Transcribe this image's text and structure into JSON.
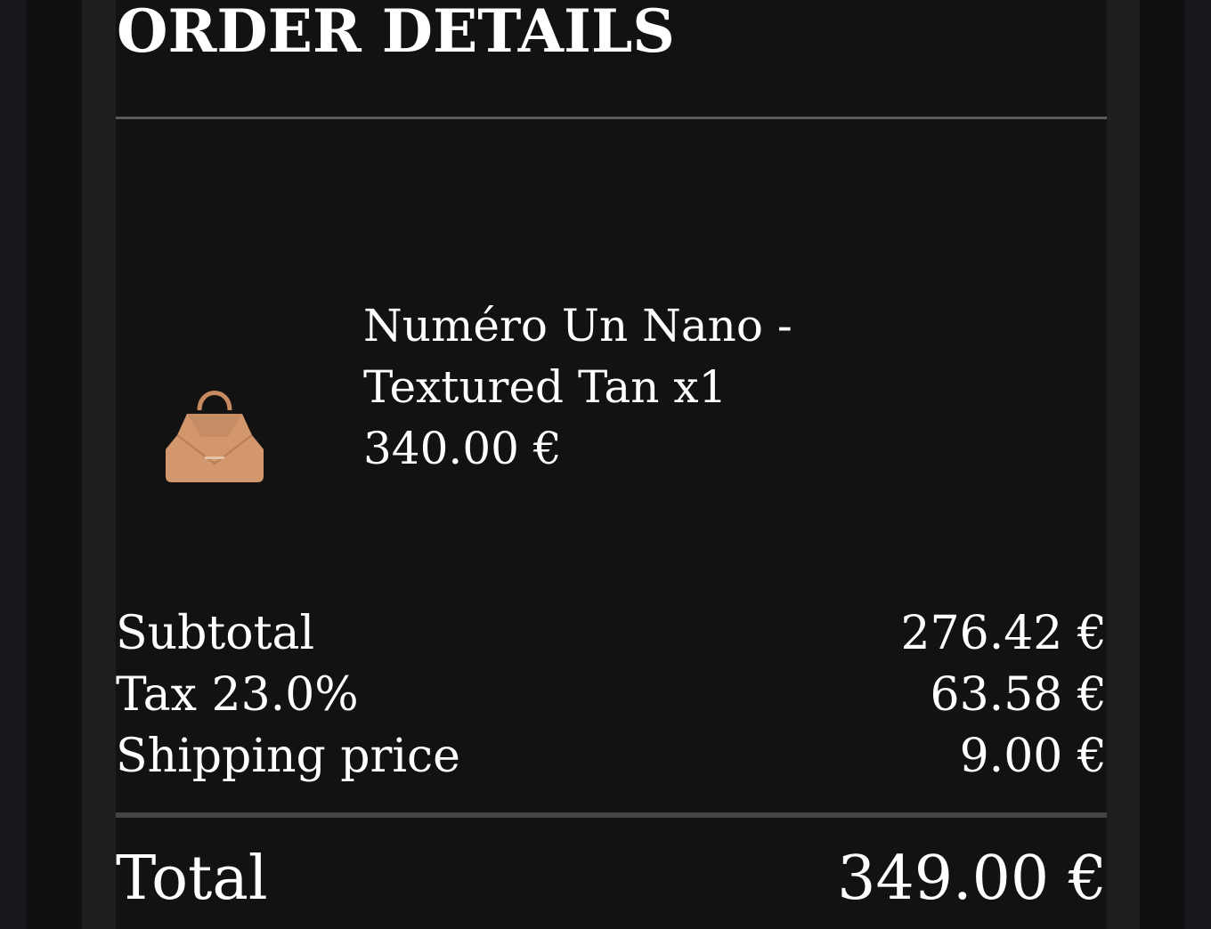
{
  "page": {
    "title": "ORDER DETAILS"
  },
  "order_item": {
    "image_icon": "handbag-icon",
    "name": "Numéro Un Nano - Textured Tan x1",
    "price": "340.00 €",
    "image_color": "#d2976d"
  },
  "summary": {
    "subtotal_label": "Subtotal",
    "subtotal_value": "276.42 €",
    "tax_label": "Tax 23.0%",
    "tax_value": "63.58 €",
    "shipping_label": "Shipping price",
    "shipping_value": "9.00 €",
    "total_label": "Total",
    "total_value": "349.00 €"
  },
  "colors": {
    "panel_background": "#121212",
    "text": "#ffffff",
    "divider": "#5a5a5a"
  }
}
